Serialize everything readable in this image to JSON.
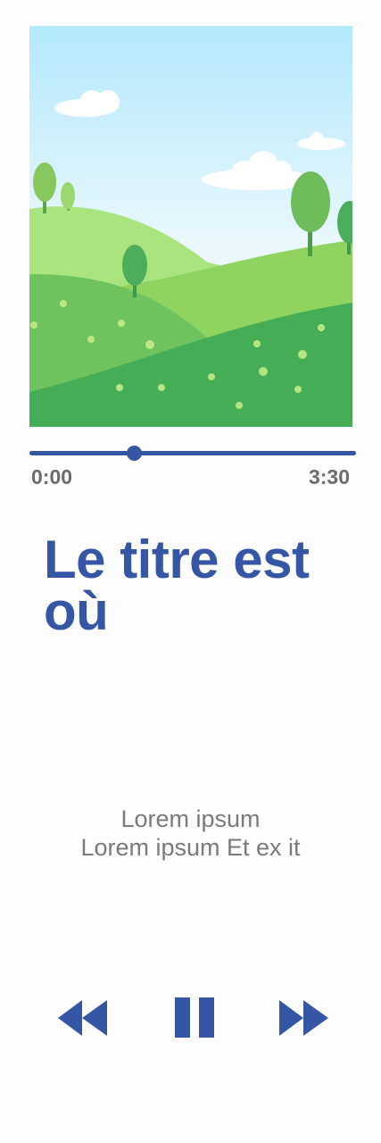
{
  "player": {
    "progress_fraction": 0.32,
    "time_start": "0:00",
    "time_end": "3:30",
    "title": "Le titre est où",
    "lyrics": [
      "Lorem ipsum",
      "Lorem ipsum Et ex it"
    ]
  },
  "controls": {
    "rewind_icon": "rewind-icon",
    "pause_icon": "pause-icon",
    "forward_icon": "fast-forward-icon"
  },
  "colors": {
    "accent": "#3456a4",
    "text_muted": "#7a7a7e",
    "background": "#fdfdfe"
  }
}
